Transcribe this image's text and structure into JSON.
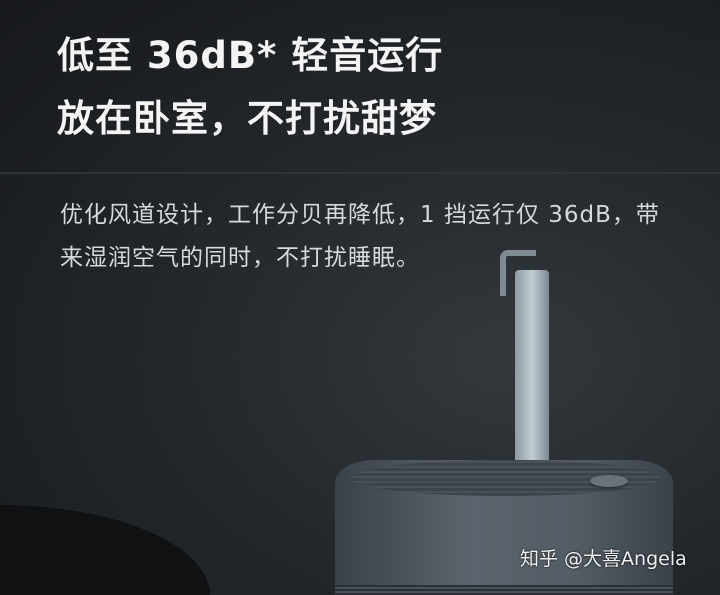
{
  "headline": {
    "line1": "低至 36dB* 轻音运行",
    "line2": "放在卧室，不打扰甜梦"
  },
  "description": "优化风道设计，工作分贝再降低，1 挡运行仅 36dB，带来湿润空气的同时，不打扰睡眠。",
  "watermark": "知乎 @大喜Angela"
}
